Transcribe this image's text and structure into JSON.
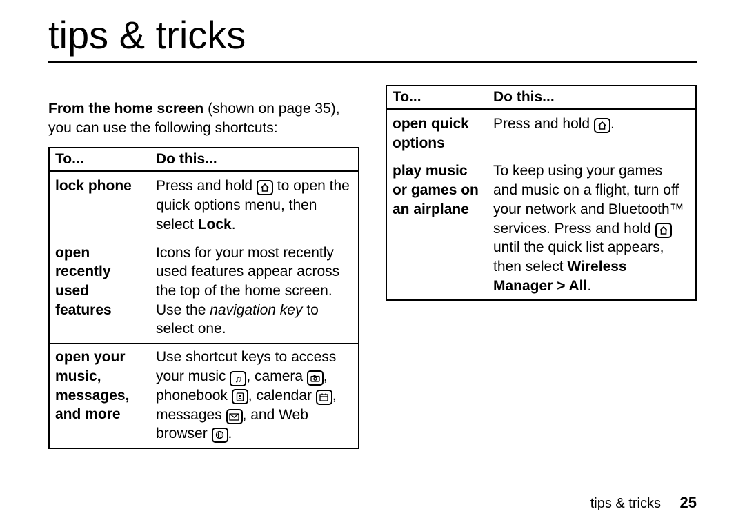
{
  "title": "tips & tricks",
  "intro_bold": "From the home screen",
  "intro_rest": " (shown on page 35), you can use the following shortcuts:",
  "headers": {
    "to": "To...",
    "do": "Do this..."
  },
  "left_rows": [
    {
      "to": "lock phone",
      "do_pre": "Press and hold ",
      "do_icon": "home",
      "do_mid": " to open the quick options menu, then select ",
      "do_bold": "Lock",
      "do_end": "."
    },
    {
      "to": "open recently used features",
      "do_pre": "Icons for your most recently used features appear across the top of the home screen. Use the ",
      "do_ital": "navigation key",
      "do_end": " to select one."
    },
    {
      "to": "open your music, messages, and more",
      "shortcut_intro": "Use shortcut keys to access your music ",
      "icon_music": "music",
      "seg1": ", camera ",
      "icon_camera": "camera",
      "seg2": ", phonebook ",
      "icon_phonebook": "phonebook",
      "seg3": ", calendar ",
      "icon_calendar": "calendar",
      "seg4": ", messages ",
      "icon_messages": "messages",
      "seg5": ", and Web browser ",
      "icon_web": "web",
      "seg6": "."
    }
  ],
  "right_rows": [
    {
      "to": "open quick options",
      "do_pre": "Press and hold ",
      "do_icon": "home",
      "do_end": "."
    },
    {
      "to": "play music or games on an airplane",
      "do_pre": "To keep using your games and music on a flight, turn off your network and Bluetooth™ services. Press and hold ",
      "do_icon": "home",
      "do_mid": " until the quick list appears, then select ",
      "do_bold": "Wireless Manager > All",
      "do_end": "."
    }
  ],
  "footer": {
    "label": "tips & tricks",
    "page": "25"
  }
}
